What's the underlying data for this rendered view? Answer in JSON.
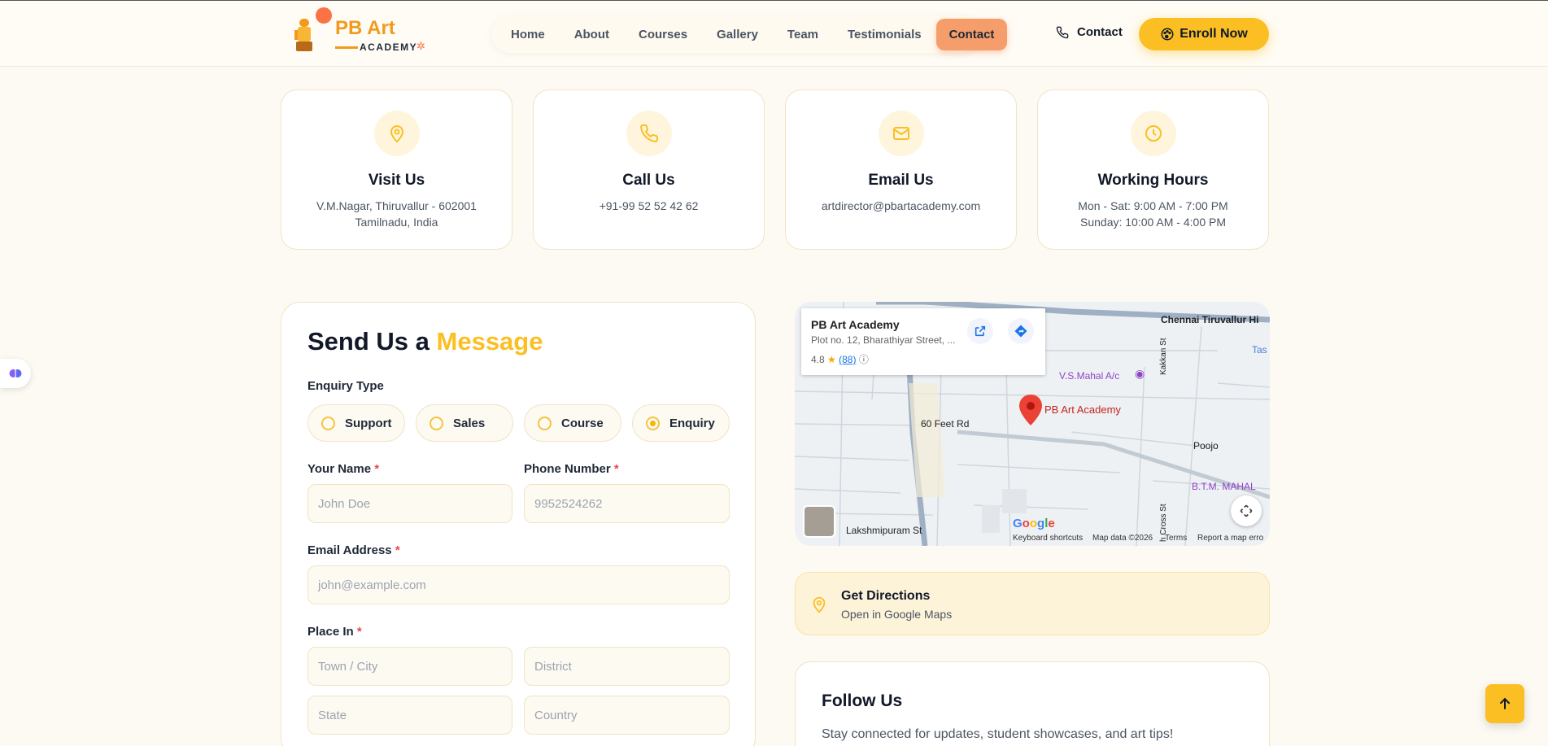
{
  "brand": {
    "name": "PB Art",
    "sub": "ACADEMY"
  },
  "nav": {
    "items": [
      "Home",
      "About",
      "Courses",
      "Gallery",
      "Team",
      "Testimonials",
      "Contact"
    ],
    "active": "Contact"
  },
  "header": {
    "contact_label": "Contact",
    "enroll_label": "Enroll Now"
  },
  "cards": [
    {
      "title": "Visit Us",
      "lines": [
        "V.M.Nagar, Thiruvallur - 602001",
        "Tamilnadu, India"
      ],
      "icon": "location-pin-icon"
    },
    {
      "title": "Call Us",
      "lines": [
        "+91-99 52 52 42 62"
      ],
      "icon": "phone-icon"
    },
    {
      "title": "Email Us",
      "lines": [
        "artdirector@pbartacademy.com"
      ],
      "icon": "mail-icon"
    },
    {
      "title": "Working Hours",
      "lines": [
        "Mon - Sat: 9:00 AM - 7:00 PM",
        "Sunday: 10:00 AM - 4:00 PM"
      ],
      "icon": "clock-icon"
    }
  ],
  "form": {
    "title_main": "Send Us a",
    "title_accent": "Message",
    "enquiry_label": "Enquiry Type",
    "enquiry_options": [
      "Support",
      "Sales",
      "Course",
      "Enquiry"
    ],
    "enquiry_selected": "Enquiry",
    "name_label": "Your Name",
    "name_placeholder": "John Doe",
    "phone_label": "Phone Number",
    "phone_placeholder": "9952524262",
    "email_label": "Email Address",
    "email_placeholder": "john@example.com",
    "place_label": "Place In",
    "town_placeholder": "Town / City",
    "district_placeholder": "District",
    "state_placeholder": "State",
    "country_placeholder": "Country",
    "required_mark": "*"
  },
  "map": {
    "place_name": "PB Art Academy",
    "address": "Plot no. 12, Bharathiyar Street, ...",
    "rating": "4.8",
    "review_count": "(88)",
    "labels": {
      "road1": "Chennai Tiruvallur Hi",
      "road2": "60 Feet Rd",
      "road3": "Lakshmipuram St",
      "poi1": "V.S.Mahal A/c",
      "poi2": "B.T.M. MAHAL",
      "pin": "PB Art Academy",
      "street1": "Kakkan St",
      "street2": "Poojo",
      "street3": "Tas",
      "street4": "h Cross St"
    },
    "footer": [
      "Keyboard shortcuts",
      "Map data ©2026",
      "Terms",
      "Report a map erro"
    ],
    "google": "Google"
  },
  "directions": {
    "title": "Get Directions",
    "subtitle": "Open in Google Maps"
  },
  "follow": {
    "title": "Follow Us",
    "subtitle": "Stay connected for updates, student showcases, and art tips!"
  },
  "colors": {
    "accent": "#fbbf24",
    "active_nav": "#f59e6b",
    "pin": "#ea4335"
  }
}
